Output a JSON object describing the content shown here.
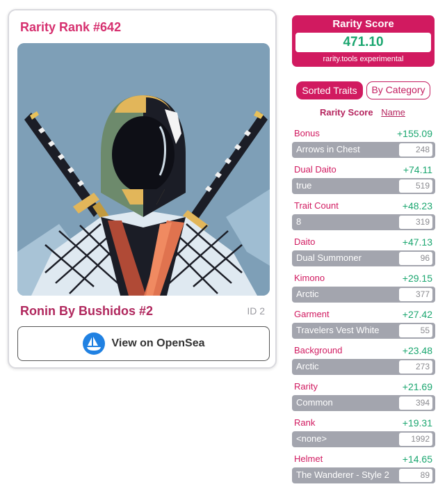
{
  "card": {
    "rank_title": "Rarity Rank #642",
    "nft_name": "Ronin By Bushidos #2",
    "nft_id": "ID 2",
    "opensea_label": "View on OpenSea"
  },
  "score": {
    "title": "Rarity Score",
    "value": "471.10",
    "subtitle": "rarity.tools experimental"
  },
  "tabs": {
    "sorted": "Sorted Traits",
    "by_category": "By Category"
  },
  "sort": {
    "active": "Rarity Score",
    "other": "Name"
  },
  "traits": [
    {
      "category": "Bonus",
      "score": "+155.09",
      "value": "Arrows in Chest",
      "count": "248"
    },
    {
      "category": "Dual Daito",
      "score": "+74.11",
      "value": "true",
      "count": "519"
    },
    {
      "category": "Trait Count",
      "score": "+48.23",
      "value": "8",
      "count": "319"
    },
    {
      "category": "Daito",
      "score": "+47.13",
      "value": "Dual Summoner",
      "count": "96"
    },
    {
      "category": "Kimono",
      "score": "+29.15",
      "value": "Arctic",
      "count": "377"
    },
    {
      "category": "Garment",
      "score": "+27.42",
      "value": "Travelers Vest White",
      "count": "55"
    },
    {
      "category": "Background",
      "score": "+23.48",
      "value": "Arctic",
      "count": "273"
    },
    {
      "category": "Rarity",
      "score": "+21.69",
      "value": "Common",
      "count": "394"
    },
    {
      "category": "Rank",
      "score": "+19.31",
      "value": "<none>",
      "count": "1992"
    },
    {
      "category": "Helmet",
      "score": "+14.65",
      "value": "The Wanderer - Style 2",
      "count": "89"
    }
  ],
  "colors": {
    "accent": "#d11a60",
    "score_green": "#1aa66f",
    "trait_bar": "#a3a5ae",
    "opensea_blue": "#2081e2"
  },
  "icons": {
    "opensea": "opensea-boat-icon"
  }
}
